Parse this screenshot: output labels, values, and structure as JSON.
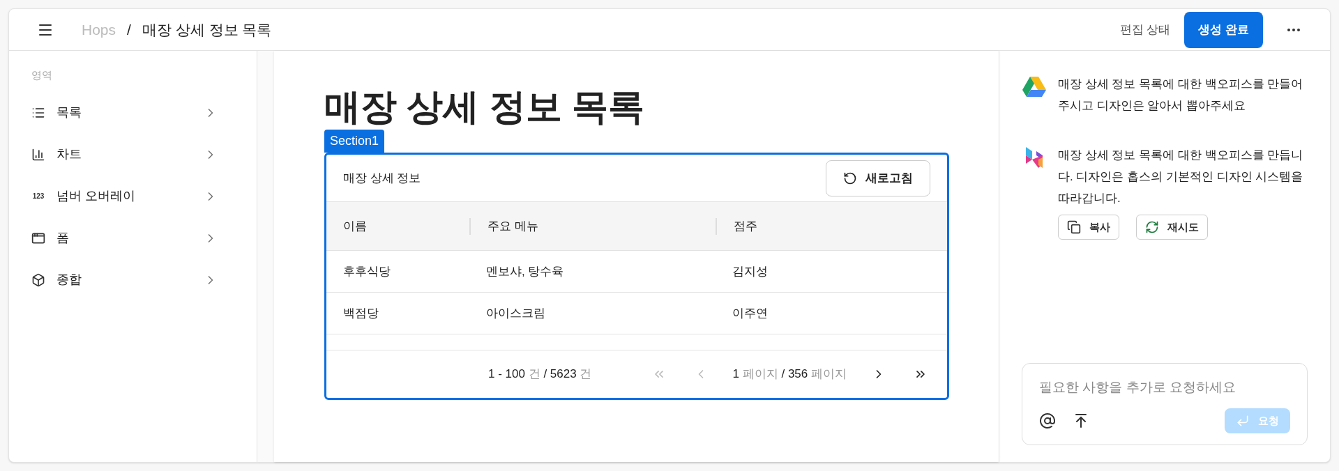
{
  "header": {
    "breadcrumb_root": "Hops",
    "breadcrumb_separator": "/",
    "breadcrumb_current": "매장 상세 정보 목록",
    "status_label": "편집 상태",
    "primary_button": "생성 완료"
  },
  "sidebar": {
    "section_label": "영역",
    "items": [
      {
        "label": "목록"
      },
      {
        "label": "차트"
      },
      {
        "label": "넘버 오버레이",
        "icon_text": "123"
      },
      {
        "label": "폼"
      },
      {
        "label": "종합"
      }
    ]
  },
  "page": {
    "title": "매장 상세 정보 목록",
    "section_tag": "Section1",
    "table": {
      "title": "매장 상세 정보",
      "refresh_button": "새로고침",
      "columns": [
        "이름",
        "주요 메뉴",
        "점주"
      ],
      "rows": [
        [
          "후후식당",
          "멘보샤, 탕수육",
          "김지성"
        ],
        [
          "백점당",
          "아이스크림",
          "이주연"
        ]
      ],
      "pagination": {
        "range_parts": [
          {
            "text": "1 - 100",
            "muted": false
          },
          {
            "text": "건",
            "muted": true
          },
          {
            "text": "/",
            "muted": false
          },
          {
            "text": "5623",
            "muted": false
          },
          {
            "text": "건",
            "muted": true
          }
        ],
        "page_parts": [
          {
            "text": "1",
            "muted": false
          },
          {
            "text": "페이지",
            "muted": true
          },
          {
            "text": "/",
            "muted": false
          },
          {
            "text": "356",
            "muted": false
          },
          {
            "text": "페이지",
            "muted": true
          }
        ],
        "first_disabled": true,
        "prev_disabled": true,
        "next_disabled": false,
        "last_disabled": false
      }
    }
  },
  "chat": {
    "messages": [
      {
        "kind": "user",
        "text": "매장 상세 정보 목록에 대한 백오피스를 만들어주시고 디자인은 알아서 뽑아주세요"
      },
      {
        "kind": "assistant",
        "text": "매장 상세 정보 목록에 대한 백오피스를 만듭니다. 디자인은 홉스의 기본적인 디자인 시스템을 따라갑니다.",
        "actions": [
          {
            "kind": "copy",
            "label": "복사"
          },
          {
            "kind": "retry",
            "label": "재시도"
          }
        ]
      }
    ],
    "input": {
      "placeholder": "필요한 사항을 추가로 요청하세요",
      "send_label": "요청",
      "send_disabled": true
    }
  }
}
